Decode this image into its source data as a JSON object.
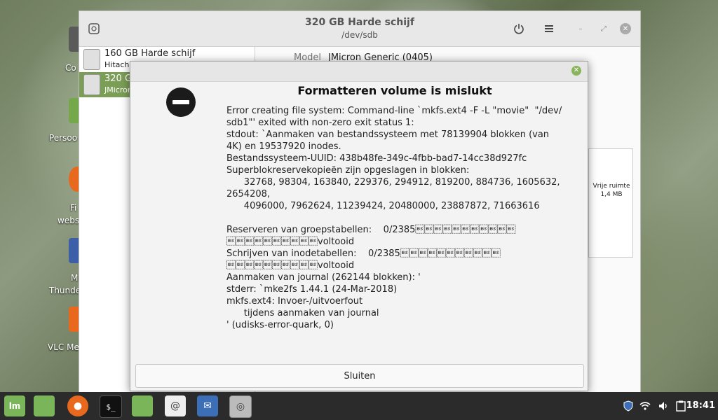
{
  "desktop": {
    "icons": [
      {
        "label": "Co",
        "color": "#5a5a5a"
      },
      {
        "label": "Persoo",
        "color": "#74a84a"
      },
      {
        "label": "Fi",
        "color": "#e8681e"
      },
      {
        "label": "webs",
        "color": ""
      },
      {
        "label": "M",
        "color": "#3d5fa8"
      },
      {
        "label": "Thunde",
        "color": ""
      },
      {
        "label": "VLC Me",
        "color": "#e8681e"
      }
    ]
  },
  "disks_window": {
    "title": "320 GB Harde schijf",
    "subtitle": "/dev/sdb",
    "power_icon": "power-icon",
    "menu_icon": "hamburger-icon",
    "wm_buttons": [
      "minimize-icon",
      "maximize-icon",
      "close-icon"
    ],
    "sidebar": [
      {
        "name": "160 GB Harde schijf",
        "sub": "Hitachi"
      },
      {
        "name": "320 G",
        "sub": "JMicron"
      }
    ],
    "model_label": "Model",
    "model_value": "JMicron Generic (0405)",
    "free_label": "Vrije ruimte",
    "free_size": "1,4 MB"
  },
  "dialog": {
    "title": "Formatteren volume is mislukt",
    "body": "Error creating file system: Command-line `mkfs.ext4 -F -L \"movie\"  \"/dev/\nsdb1\"' exited with non-zero exit status 1:\nstdout: `Aanmaken van bestandssysteem met 78139904 blokken (van\n4K) en 19537920 inodes.\nBestandssysteem-UUID: 438b48fe-349c-4fbb-bad7-14cc38d927fc\nSuperblokreservekopieën zijn opgeslagen in blokken:\n      32768, 98304, 163840, 229376, 294912, 819200, 884736, 1605632,\n2654208,\n      4096000, 7962624, 11239424, 20480000, 23887872, 71663616\n\nReserveren van groepstabellen:    0/2385\b\b\b\b\b\b\b\b\b\b\b\n\b\b\b\b\b\b\b\b\b\bvoltooid\nSchrijven van inodetabellen:    0/2385\b\b\b\b\b\b\b\b\b\b\b\n\b\b\b\b\b\b\b\b\b\bvoltooid\nAanmaken van journal (262144 blokken): '\nstderr: `mke2fs 1.44.1 (24-Mar-2018)\nmkfs.ext4: Invoer-/uitvoerfout\n      tijdens aanmaken van journal\n' (udisks-error-quark, 0)",
    "close_button": "Sluiten"
  },
  "taskbar": {
    "apps": [
      {
        "name": "mint-menu-icon",
        "glyph": "lm",
        "color": "#7bb55a"
      },
      {
        "name": "files-icon",
        "glyph": "",
        "color": "#7bb55a"
      },
      {
        "name": "firefox-icon",
        "glyph": "●",
        "color": "#e8681e"
      },
      {
        "name": "terminal-icon",
        "glyph": "$_",
        "color": "#111111"
      },
      {
        "name": "folder-icon",
        "glyph": "",
        "color": "#7bb55a"
      },
      {
        "name": "email-app-icon",
        "glyph": "@",
        "color": "#eeeeee"
      },
      {
        "name": "thunderbird-icon",
        "glyph": "✉",
        "color": "#3d6fb8"
      },
      {
        "name": "disks-icon",
        "glyph": "◎",
        "color": "#bbbbbb"
      }
    ],
    "clock": "18:41"
  }
}
